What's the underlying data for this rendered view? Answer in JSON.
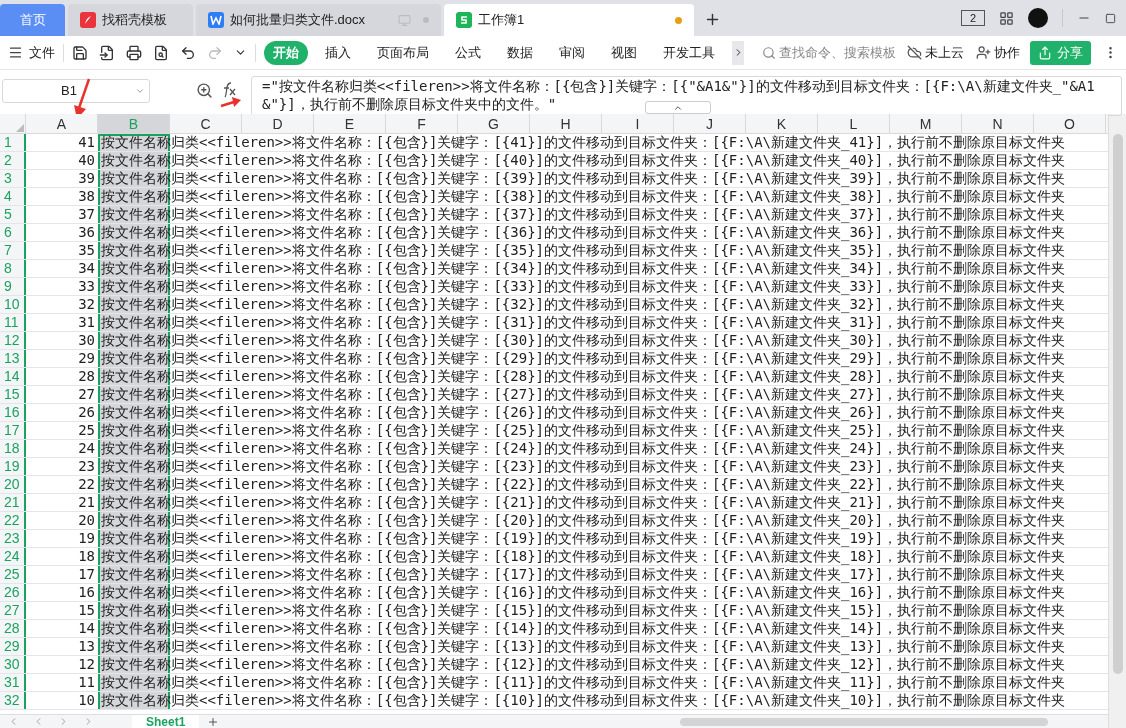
{
  "tabs": [
    {
      "label": "首页",
      "kind": "home",
      "selected": false
    },
    {
      "label": "找稻壳模板",
      "kind": "docer",
      "selected": false
    },
    {
      "label": "如何批量归类文件.docx",
      "kind": "word",
      "selected": false
    },
    {
      "label": "工作簿1",
      "kind": "sheet",
      "selected": true,
      "unsaved": true
    }
  ],
  "toolbar": {
    "file_menu": "文件",
    "ribbon_tabs": [
      {
        "label": "开始",
        "selected": true
      },
      {
        "label": "插入",
        "selected": false
      },
      {
        "label": "页面布局",
        "selected": false
      },
      {
        "label": "公式",
        "selected": false
      },
      {
        "label": "数据",
        "selected": false
      },
      {
        "label": "审阅",
        "selected": false
      },
      {
        "label": "视图",
        "selected": false
      },
      {
        "label": "开发工具",
        "selected": false
      }
    ],
    "search": {
      "placeholder": "查找命令、搜索模板"
    },
    "cloud": "未上云",
    "collab": "协作",
    "share": "分享",
    "page_badge": "2"
  },
  "name_box": "B1",
  "formula": "=\"按文件名称归类<<fileren>>将文件名称：[{包含}]关键字：[{\"&A1&\"}]的文件移动到目标文件夹：[{F:\\A\\新建文件夹_\"&A1&\"}]，执行前不删除原目标文件夹中的文件。\"",
  "columns": [
    {
      "label": "A",
      "selected": false
    },
    {
      "label": "B",
      "selected": true
    },
    {
      "label": "C",
      "selected": false
    },
    {
      "label": "D",
      "selected": false
    },
    {
      "label": "E",
      "selected": false
    },
    {
      "label": "F",
      "selected": false
    },
    {
      "label": "G",
      "selected": false
    },
    {
      "label": "H",
      "selected": false
    },
    {
      "label": "I",
      "selected": false
    },
    {
      "label": "J",
      "selected": false
    },
    {
      "label": "K",
      "selected": false
    },
    {
      "label": "L",
      "selected": false
    },
    {
      "label": "M",
      "selected": false
    },
    {
      "label": "N",
      "selected": false
    },
    {
      "label": "O",
      "selected": false
    }
  ],
  "rows": [
    {
      "num": "1",
      "a": "41",
      "b": "按文件名称归类<<fileren>>将文件名称：[{包含}]关键字：[{41}]的文件移动到目标文件夹：[{F:\\A\\新建文件夹_41}]，执行前不删除原目标文件夹"
    },
    {
      "num": "2",
      "a": "40",
      "b": "按文件名称归类<<fileren>>将文件名称：[{包含}]关键字：[{40}]的文件移动到目标文件夹：[{F:\\A\\新建文件夹_40}]，执行前不删除原目标文件夹"
    },
    {
      "num": "3",
      "a": "39",
      "b": "按文件名称归类<<fileren>>将文件名称：[{包含}]关键字：[{39}]的文件移动到目标文件夹：[{F:\\A\\新建文件夹_39}]，执行前不删除原目标文件夹"
    },
    {
      "num": "4",
      "a": "38",
      "b": "按文件名称归类<<fileren>>将文件名称：[{包含}]关键字：[{38}]的文件移动到目标文件夹：[{F:\\A\\新建文件夹_38}]，执行前不删除原目标文件夹"
    },
    {
      "num": "5",
      "a": "37",
      "b": "按文件名称归类<<fileren>>将文件名称：[{包含}]关键字：[{37}]的文件移动到目标文件夹：[{F:\\A\\新建文件夹_37}]，执行前不删除原目标文件夹"
    },
    {
      "num": "6",
      "a": "36",
      "b": "按文件名称归类<<fileren>>将文件名称：[{包含}]关键字：[{36}]的文件移动到目标文件夹：[{F:\\A\\新建文件夹_36}]，执行前不删除原目标文件夹"
    },
    {
      "num": "7",
      "a": "35",
      "b": "按文件名称归类<<fileren>>将文件名称：[{包含}]关键字：[{35}]的文件移动到目标文件夹：[{F:\\A\\新建文件夹_35}]，执行前不删除原目标文件夹"
    },
    {
      "num": "8",
      "a": "34",
      "b": "按文件名称归类<<fileren>>将文件名称：[{包含}]关键字：[{34}]的文件移动到目标文件夹：[{F:\\A\\新建文件夹_34}]，执行前不删除原目标文件夹"
    },
    {
      "num": "9",
      "a": "33",
      "b": "按文件名称归类<<fileren>>将文件名称：[{包含}]关键字：[{33}]的文件移动到目标文件夹：[{F:\\A\\新建文件夹_33}]，执行前不删除原目标文件夹"
    },
    {
      "num": "10",
      "a": "32",
      "b": "按文件名称归类<<fileren>>将文件名称：[{包含}]关键字：[{32}]的文件移动到目标文件夹：[{F:\\A\\新建文件夹_32}]，执行前不删除原目标文件夹"
    },
    {
      "num": "11",
      "a": "31",
      "b": "按文件名称归类<<fileren>>将文件名称：[{包含}]关键字：[{31}]的文件移动到目标文件夹：[{F:\\A\\新建文件夹_31}]，执行前不删除原目标文件夹"
    },
    {
      "num": "12",
      "a": "30",
      "b": "按文件名称归类<<fileren>>将文件名称：[{包含}]关键字：[{30}]的文件移动到目标文件夹：[{F:\\A\\新建文件夹_30}]，执行前不删除原目标文件夹"
    },
    {
      "num": "13",
      "a": "29",
      "b": "按文件名称归类<<fileren>>将文件名称：[{包含}]关键字：[{29}]的文件移动到目标文件夹：[{F:\\A\\新建文件夹_29}]，执行前不删除原目标文件夹"
    },
    {
      "num": "14",
      "a": "28",
      "b": "按文件名称归类<<fileren>>将文件名称：[{包含}]关键字：[{28}]的文件移动到目标文件夹：[{F:\\A\\新建文件夹_28}]，执行前不删除原目标文件夹"
    },
    {
      "num": "15",
      "a": "27",
      "b": "按文件名称归类<<fileren>>将文件名称：[{包含}]关键字：[{27}]的文件移动到目标文件夹：[{F:\\A\\新建文件夹_27}]，执行前不删除原目标文件夹"
    },
    {
      "num": "16",
      "a": "26",
      "b": "按文件名称归类<<fileren>>将文件名称：[{包含}]关键字：[{26}]的文件移动到目标文件夹：[{F:\\A\\新建文件夹_26}]，执行前不删除原目标文件夹"
    },
    {
      "num": "17",
      "a": "25",
      "b": "按文件名称归类<<fileren>>将文件名称：[{包含}]关键字：[{25}]的文件移动到目标文件夹：[{F:\\A\\新建文件夹_25}]，执行前不删除原目标文件夹"
    },
    {
      "num": "18",
      "a": "24",
      "b": "按文件名称归类<<fileren>>将文件名称：[{包含}]关键字：[{24}]的文件移动到目标文件夹：[{F:\\A\\新建文件夹_24}]，执行前不删除原目标文件夹"
    },
    {
      "num": "19",
      "a": "23",
      "b": "按文件名称归类<<fileren>>将文件名称：[{包含}]关键字：[{23}]的文件移动到目标文件夹：[{F:\\A\\新建文件夹_23}]，执行前不删除原目标文件夹"
    },
    {
      "num": "20",
      "a": "22",
      "b": "按文件名称归类<<fileren>>将文件名称：[{包含}]关键字：[{22}]的文件移动到目标文件夹：[{F:\\A\\新建文件夹_22}]，执行前不删除原目标文件夹"
    },
    {
      "num": "21",
      "a": "21",
      "b": "按文件名称归类<<fileren>>将文件名称：[{包含}]关键字：[{21}]的文件移动到目标文件夹：[{F:\\A\\新建文件夹_21}]，执行前不删除原目标文件夹"
    },
    {
      "num": "22",
      "a": "20",
      "b": "按文件名称归类<<fileren>>将文件名称：[{包含}]关键字：[{20}]的文件移动到目标文件夹：[{F:\\A\\新建文件夹_20}]，执行前不删除原目标文件夹"
    },
    {
      "num": "23",
      "a": "19",
      "b": "按文件名称归类<<fileren>>将文件名称：[{包含}]关键字：[{19}]的文件移动到目标文件夹：[{F:\\A\\新建文件夹_19}]，执行前不删除原目标文件夹"
    },
    {
      "num": "24",
      "a": "18",
      "b": "按文件名称归类<<fileren>>将文件名称：[{包含}]关键字：[{18}]的文件移动到目标文件夹：[{F:\\A\\新建文件夹_18}]，执行前不删除原目标文件夹"
    },
    {
      "num": "25",
      "a": "17",
      "b": "按文件名称归类<<fileren>>将文件名称：[{包含}]关键字：[{17}]的文件移动到目标文件夹：[{F:\\A\\新建文件夹_17}]，执行前不删除原目标文件夹"
    },
    {
      "num": "26",
      "a": "16",
      "b": "按文件名称归类<<fileren>>将文件名称：[{包含}]关键字：[{16}]的文件移动到目标文件夹：[{F:\\A\\新建文件夹_16}]，执行前不删除原目标文件夹"
    },
    {
      "num": "27",
      "a": "15",
      "b": "按文件名称归类<<fileren>>将文件名称：[{包含}]关键字：[{15}]的文件移动到目标文件夹：[{F:\\A\\新建文件夹_15}]，执行前不删除原目标文件夹"
    },
    {
      "num": "28",
      "a": "14",
      "b": "按文件名称归类<<fileren>>将文件名称：[{包含}]关键字：[{14}]的文件移动到目标文件夹：[{F:\\A\\新建文件夹_14}]，执行前不删除原目标文件夹"
    },
    {
      "num": "29",
      "a": "13",
      "b": "按文件名称归类<<fileren>>将文件名称：[{包含}]关键字：[{13}]的文件移动到目标文件夹：[{F:\\A\\新建文件夹_13}]，执行前不删除原目标文件夹"
    },
    {
      "num": "30",
      "a": "12",
      "b": "按文件名称归类<<fileren>>将文件名称：[{包含}]关键字：[{12}]的文件移动到目标文件夹：[{F:\\A\\新建文件夹_12}]，执行前不删除原目标文件夹"
    },
    {
      "num": "31",
      "a": "11",
      "b": "按文件名称归类<<fileren>>将文件名称：[{包含}]关键字：[{11}]的文件移动到目标文件夹：[{F:\\A\\新建文件夹_11}]，执行前不删除原目标文件夹"
    },
    {
      "num": "32",
      "a": "10",
      "b": "按文件名称归类<<fileren>>将文件名称：[{包含}]关键字：[{10}]的文件移动到目标文件夹：[{F:\\A\\新建文件夹_10}]，执行前不删除原目标文件夹"
    }
  ],
  "sheets": [
    {
      "label": "Sheet1",
      "selected": true
    }
  ]
}
